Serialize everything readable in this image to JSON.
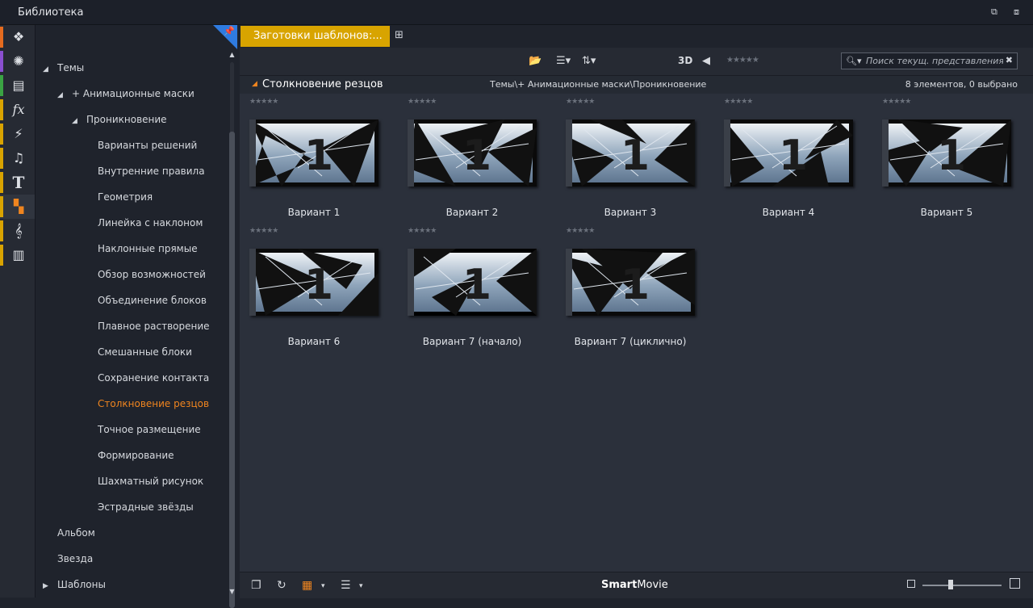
{
  "window": {
    "title": "Библиотека"
  },
  "sidebar_icons": [
    {
      "name": "project-bin-icon",
      "glyph": "❖",
      "color": "#e56b1f"
    },
    {
      "name": "video-reel-icon",
      "glyph": "✺",
      "color": "#8a4fd0"
    },
    {
      "name": "photo-stack-icon",
      "glyph": "▤",
      "color": "#3aa343"
    },
    {
      "name": "fx-icon",
      "glyph": "fx",
      "color": "#d9a300"
    },
    {
      "name": "lightning-icon",
      "glyph": "⚡",
      "color": "#d9a300"
    },
    {
      "name": "music-note-icon",
      "glyph": "♫",
      "color": "#d9a300"
    },
    {
      "name": "title-text-icon",
      "glyph": "T",
      "color": "#d9a300"
    },
    {
      "name": "montage-template-icon",
      "glyph": "▚",
      "color": "#d9a300",
      "active": true
    },
    {
      "name": "treble-clef-icon",
      "glyph": "𝄞",
      "color": "#d9a300"
    },
    {
      "name": "piano-keys-icon",
      "glyph": "▥",
      "color": "#d9a300"
    }
  ],
  "tree": {
    "items": [
      {
        "label": "Темы",
        "indent": 0,
        "arrow": "◢"
      },
      {
        "label": "+ Анимационные маски",
        "indent": 1,
        "arrow": "◢"
      },
      {
        "label": "Проникновение",
        "indent": 2,
        "arrow": "◢"
      },
      {
        "label": "Варианты решений",
        "indent": 3
      },
      {
        "label": "Внутренние правила",
        "indent": 3
      },
      {
        "label": "Геометрия",
        "indent": 3
      },
      {
        "label": "Линейка с наклоном",
        "indent": 3
      },
      {
        "label": "Наклонные прямые",
        "indent": 3
      },
      {
        "label": "Обзор возможностей",
        "indent": 3
      },
      {
        "label": "Объединение блоков",
        "indent": 3
      },
      {
        "label": "Плавное растворение",
        "indent": 3
      },
      {
        "label": "Смешанные блоки",
        "indent": 3
      },
      {
        "label": "Сохранение контакта",
        "indent": 3
      },
      {
        "label": "Столкновение резцов",
        "indent": 3,
        "selected": true
      },
      {
        "label": "Точное размещение",
        "indent": 3
      },
      {
        "label": "Формирование",
        "indent": 3
      },
      {
        "label": "Шахматный рисунок",
        "indent": 3
      },
      {
        "label": "Эстрадные звёзды",
        "indent": 3
      },
      {
        "label": "Альбом",
        "indent": 1
      },
      {
        "label": "Звезда",
        "indent": 1
      },
      {
        "label": "Шаблоны",
        "indent": 0,
        "arrow": "▶"
      }
    ]
  },
  "tab": {
    "label": "Заготовки шаблонов:..."
  },
  "toolbar": {
    "view_3d_label": "3D",
    "rating_stars": "★★★★★",
    "search_placeholder": "Поиск текущ. представления"
  },
  "header": {
    "collection_name": "Столкновение резцов",
    "path": "Темы\\+ Анимационные маски\\Проникновение",
    "count": "8 элементов, 0 выбрано"
  },
  "items": [
    {
      "label": "Вариант 1",
      "rating": "★★★★★",
      "digit": "1"
    },
    {
      "label": "Вариант 2",
      "rating": "★★★★★",
      "digit": "1"
    },
    {
      "label": "Вариант 3",
      "rating": "★★★★★",
      "digit": "1"
    },
    {
      "label": "Вариант 4",
      "rating": "★★★★★",
      "digit": "1"
    },
    {
      "label": "Вариант 5",
      "rating": "★★★★★",
      "digit": "1"
    },
    {
      "label": "Вариант 6",
      "rating": "★★★★★",
      "digit": "1"
    },
    {
      "label": "Вариант 7 (начало)",
      "rating": "★★★★★",
      "digit": "1"
    },
    {
      "label": "Вариант 7 (циклично)",
      "rating": "★★★★★",
      "digit": "1"
    }
  ],
  "footer": {
    "brand_bold": "Smart",
    "brand_rest": "Movie"
  }
}
